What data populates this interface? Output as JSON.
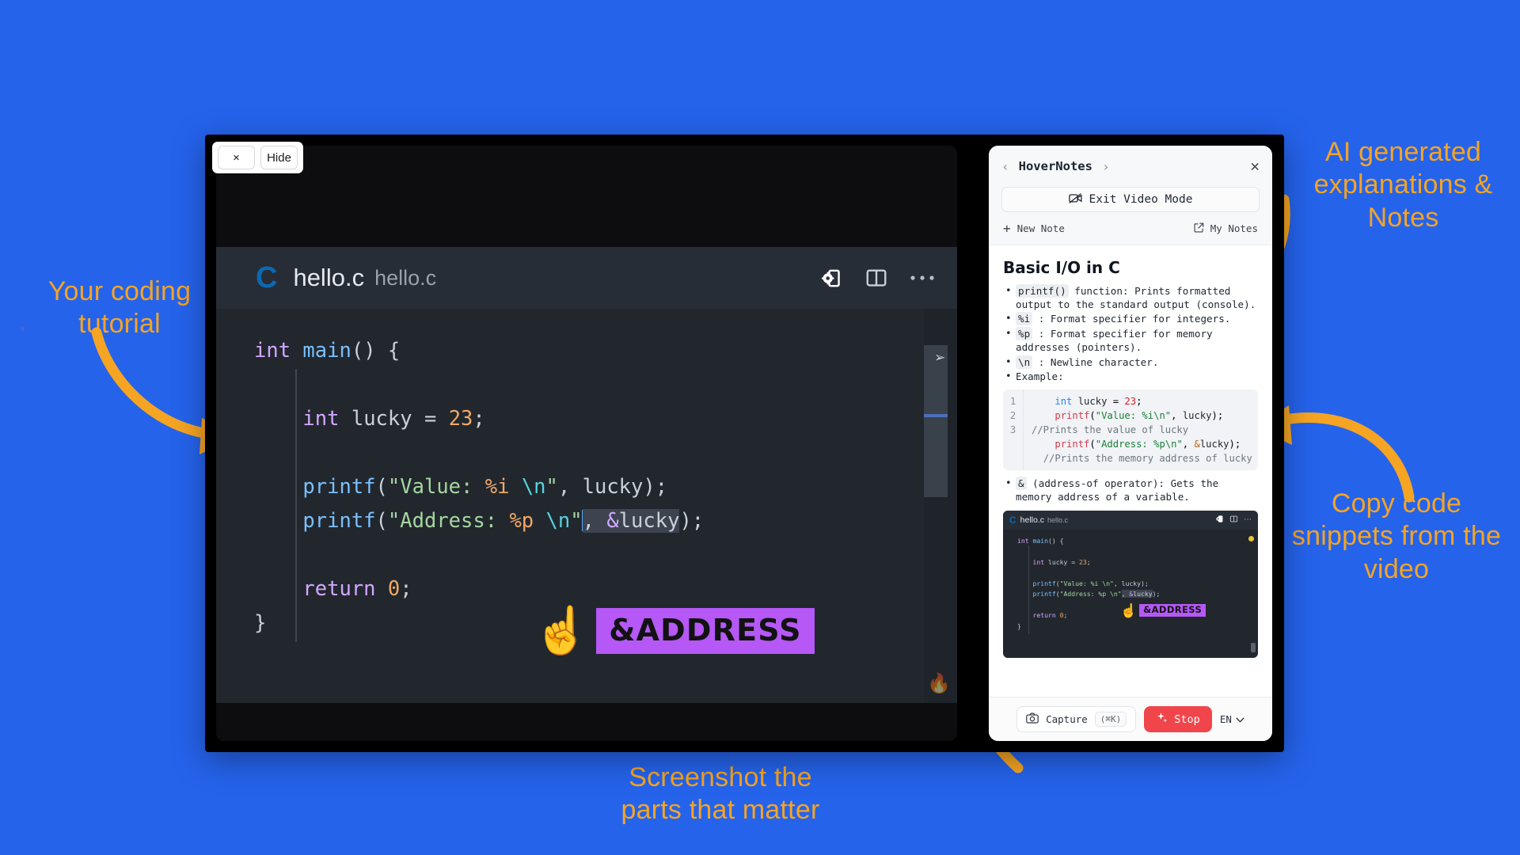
{
  "theme": {
    "background": "#2563eb",
    "annotation_color": "#F5A423",
    "accent_purple": "#b558f6",
    "stop_red": "#f0464b"
  },
  "annotations": {
    "left": "Your coding\ntutorial",
    "top_right": "AI generated\nexplanations &\nNotes",
    "bottom_right": "Copy code\nsnippets from the\nvideo",
    "bottom": "Screenshot the\nparts that matter"
  },
  "recorder": {
    "close_label": "×",
    "hide_label": "Hide"
  },
  "editor": {
    "logo": "C",
    "filename": "hello.c",
    "filepath": "hello.c",
    "tools": [
      "settings-screen-icon",
      "split-panel-icon",
      "more-options-icon"
    ],
    "code_lines": [
      "int main() {",
      "",
      "    int lucky = 23;",
      "",
      "    printf(\"Value: %i \\n\", lucky);",
      "    printf(\"Address: %p \\n\", &lucky);",
      "",
      "    return 0;",
      "}"
    ],
    "overlay_badge": "&ADDRESS",
    "overlay_emoji": "☝️",
    "flame_icon": "🔥"
  },
  "notes_panel": {
    "title": "HoverNotes",
    "back_icon": "‹",
    "forward_icon": "›",
    "close_icon": "✕",
    "exit_video_label": "Exit Video Mode",
    "new_note_label": "New Note",
    "new_note_icon": "+",
    "my_notes_label": "My Notes",
    "my_notes_icon": "open-external-icon",
    "note_title": "Basic I/O in C",
    "bullets": [
      {
        "code": "printf()",
        "text": " function:  Prints formatted output to the standard output (console)."
      },
      {
        "code": "%i",
        "text": " : Format specifier for integers."
      },
      {
        "code": "%p",
        "text": " : Format specifier for memory addresses (pointers)."
      },
      {
        "code": "\\n",
        "text": " : Newline character."
      },
      {
        "code": "",
        "text": "Example:"
      }
    ],
    "bullet_after": {
      "code": "&",
      "text": " (address-of operator):  Gets the memory address of a variable."
    },
    "snippet_gutter": [
      "1",
      "2",
      "3"
    ],
    "snippet_lines": [
      "    int lucky = 23;",
      "    printf(\"Value: %i\\n\", lucky);",
      "//Prints the value of lucky",
      "    printf(\"Address: %p\\n\", &lucky);",
      "  //Prints the memory address of lucky"
    ],
    "thumbnail": {
      "logo": "C",
      "filename": "hello.c",
      "filepath": "hello.c",
      "badge": "&ADDRESS",
      "emoji": "☝️",
      "code_lines": [
        "int main() {",
        "",
        "    int lucky = 23;",
        "",
        "    printf(\"Value: %i \\n\", lucky);",
        "    printf(\"Address: %p \\n\", &lucky);",
        "",
        "    return 0;",
        "}"
      ]
    },
    "footer": {
      "capture_label": "Capture",
      "capture_shortcut": "⌘K",
      "capture_icon": "camera-icon",
      "stop_label": "Stop",
      "stop_icon": "sparkle-icon",
      "language": "EN",
      "language_caret": "⌄"
    }
  }
}
